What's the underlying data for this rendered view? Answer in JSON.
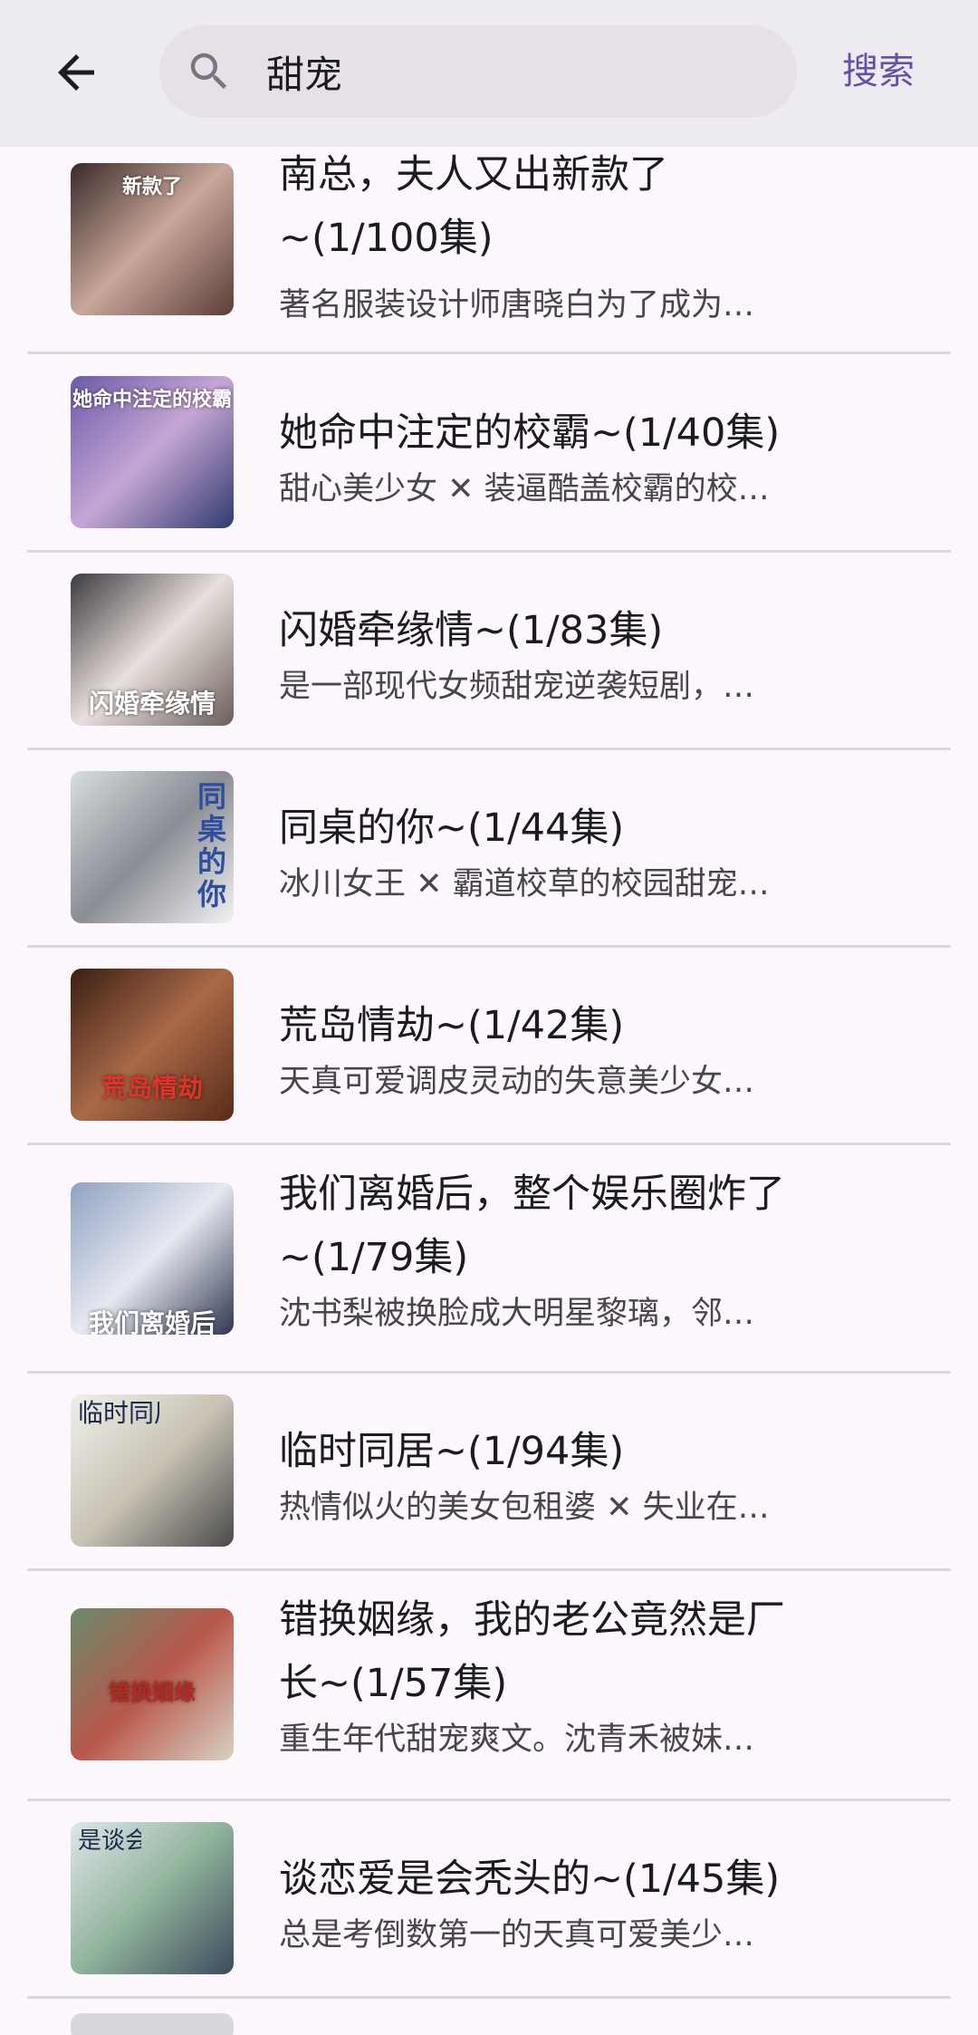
{
  "header": {
    "search_value": "甜宠",
    "search_button": "搜索"
  },
  "results": [
    {
      "title_line1": "南总，夫人又出新款了",
      "title_line2": "~(1/100集)",
      "description": "著名服装设计师唐晓白为了成为…",
      "thumb_text": "新款了",
      "thumb_colors": [
        "#3a2a2a",
        "#c9a79a",
        "#5b3e38"
      ]
    },
    {
      "title_line1": "她命中注定的校霸~(1/40集)",
      "description": "甜心美少女 ✕ 装逼酷盖校霸的校…",
      "thumb_text": "她命中注定的校霸",
      "thumb_colors": [
        "#6b5aa8",
        "#c6a6d6",
        "#2f3b6d"
      ]
    },
    {
      "title_line1": "闪婚牵缘情~(1/83集)",
      "description": "是一部现代女频甜宠逆袭短剧，…",
      "thumb_text": "闪婚牵缘情",
      "thumb_colors": [
        "#3c3a3f",
        "#e8e0dc",
        "#6a5d5a"
      ]
    },
    {
      "title_line1": "同桌的你~(1/44集)",
      "description": "冰川女王 ✕ 霸道校草的校园甜宠…",
      "thumb_text": "同桌的你",
      "thumb_colors": [
        "#d8dde0",
        "#8a8d94",
        "#f2f2f2"
      ]
    },
    {
      "title_line1": "荒岛情劫~(1/42集)",
      "description": "天真可爱调皮灵动的失意美少女…",
      "thumb_text": "荒岛情劫",
      "thumb_colors": [
        "#3a1e12",
        "#a86a48",
        "#5a2a18"
      ]
    },
    {
      "title_line1": "我们离婚后，整个娱乐圈炸了",
      "title_line2": "~(1/79集)",
      "description": "沈书梨被换脸成大明星黎璃，邻…",
      "thumb_text": "我们离婚后",
      "thumb_colors": [
        "#8fa1c2",
        "#e6e9f0",
        "#2e3650"
      ]
    },
    {
      "title_line1": "临时同居~(1/94集)",
      "description": "热情似火的美女包租婆 ✕ 失业在…",
      "thumb_text": "临时同居",
      "thumb_colors": [
        "#eef0ea",
        "#c9c3b5",
        "#4a4a4a"
      ]
    },
    {
      "title_line1": "错换姻缘，我的老公竟然是厂",
      "title_line2": "长~(1/57集)",
      "description": "重生年代甜宠爽文。沈青禾被妹…",
      "thumb_text": "错换姻缘",
      "thumb_colors": [
        "#6a8a6a",
        "#b8584a",
        "#d9d2c4"
      ]
    },
    {
      "title_line1": "谈恋爱是会秃头的~(1/45集)",
      "description": "总是考倒数第一的天真可爱美少…",
      "thumb_text": "是谈会恋秃爱头",
      "thumb_colors": [
        "#dfe6ea",
        "#8fb39a",
        "#3b4a5e"
      ]
    }
  ]
}
